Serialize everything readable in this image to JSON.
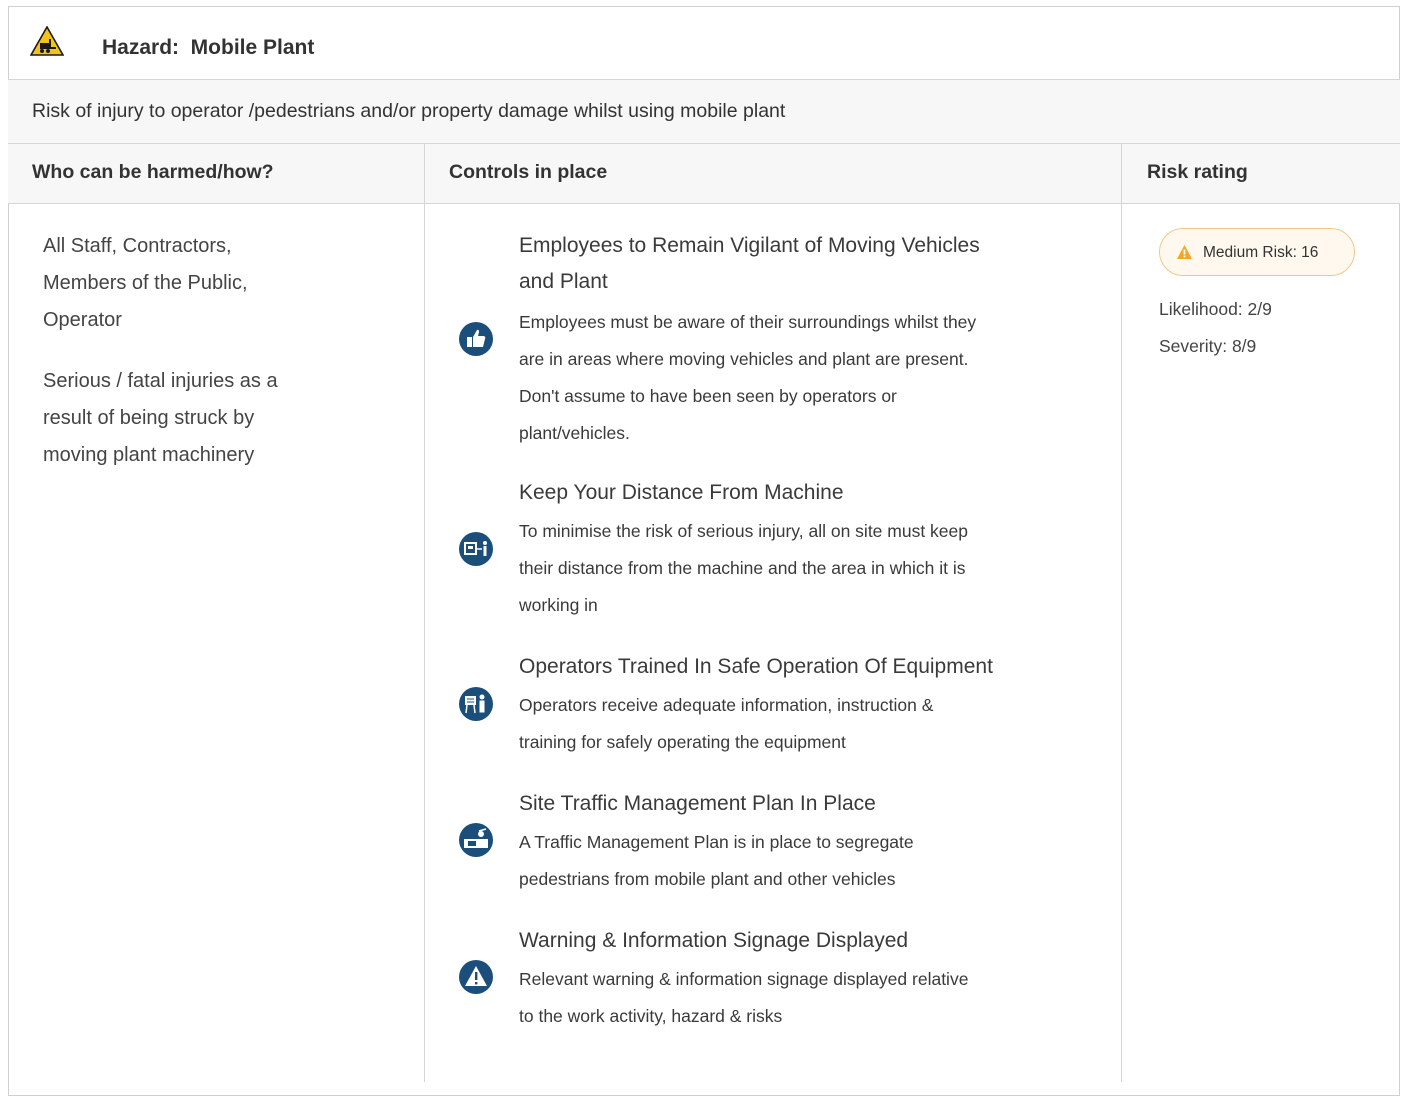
{
  "hazard": {
    "title": "Hazard:  Mobile Plant",
    "description": "Risk of injury to operator /pedestrians and/or property damage whilst using mobile plant",
    "icon": "forklift-warning-icon"
  },
  "columns": {
    "who": "Who can be harmed/how?",
    "controls": "Controls in place",
    "risk": "Risk rating"
  },
  "who": {
    "people": [
      "All Staff, Contractors,",
      "Members of the Public,",
      "Operator"
    ],
    "injury": [
      "Serious / fatal injuries as a",
      "result of being struck by",
      "moving plant machinery"
    ]
  },
  "controls": [
    {
      "icon": "thumbs-up-icon",
      "title": [
        "Employees to Remain Vigilant of Moving Vehicles",
        "and Plant"
      ],
      "body": [
        "Employees must be aware of their surroundings whilst they",
        "are in areas where moving vehicles and plant are present.",
        "Don't assume to have been seen by operators or",
        "plant/vehicles."
      ]
    },
    {
      "icon": "keep-distance-icon",
      "title": [
        "Keep Your Distance From Machine"
      ],
      "body": [
        "To minimise the risk of serious injury, all on site must keep",
        "their distance from the machine and the area in which it is",
        "working in"
      ]
    },
    {
      "icon": "training-icon",
      "title": [
        "Operators Trained In Safe Operation Of Equipment"
      ],
      "body": [
        "Operators receive adequate information, instruction &",
        "training for safely operating the equipment"
      ]
    },
    {
      "icon": "traffic-plan-icon",
      "title": [
        "Site Traffic Management Plan In Place"
      ],
      "body": [
        "A Traffic Management Plan is in place to segregate",
        "pedestrians from mobile plant and other vehicles"
      ]
    },
    {
      "icon": "warning-sign-icon",
      "title": [
        "Warning & Information Signage Displayed"
      ],
      "body": [
        "Relevant warning & information signage displayed relative",
        "to the work activity, hazard & risks"
      ]
    }
  ],
  "risk": {
    "badge": "Medium Risk: 16",
    "likelihood": "Likelihood: 2/9",
    "severity": "Severity: 8/9",
    "badge_color": "#f5a623",
    "icon_color": "#1b4e7a"
  }
}
